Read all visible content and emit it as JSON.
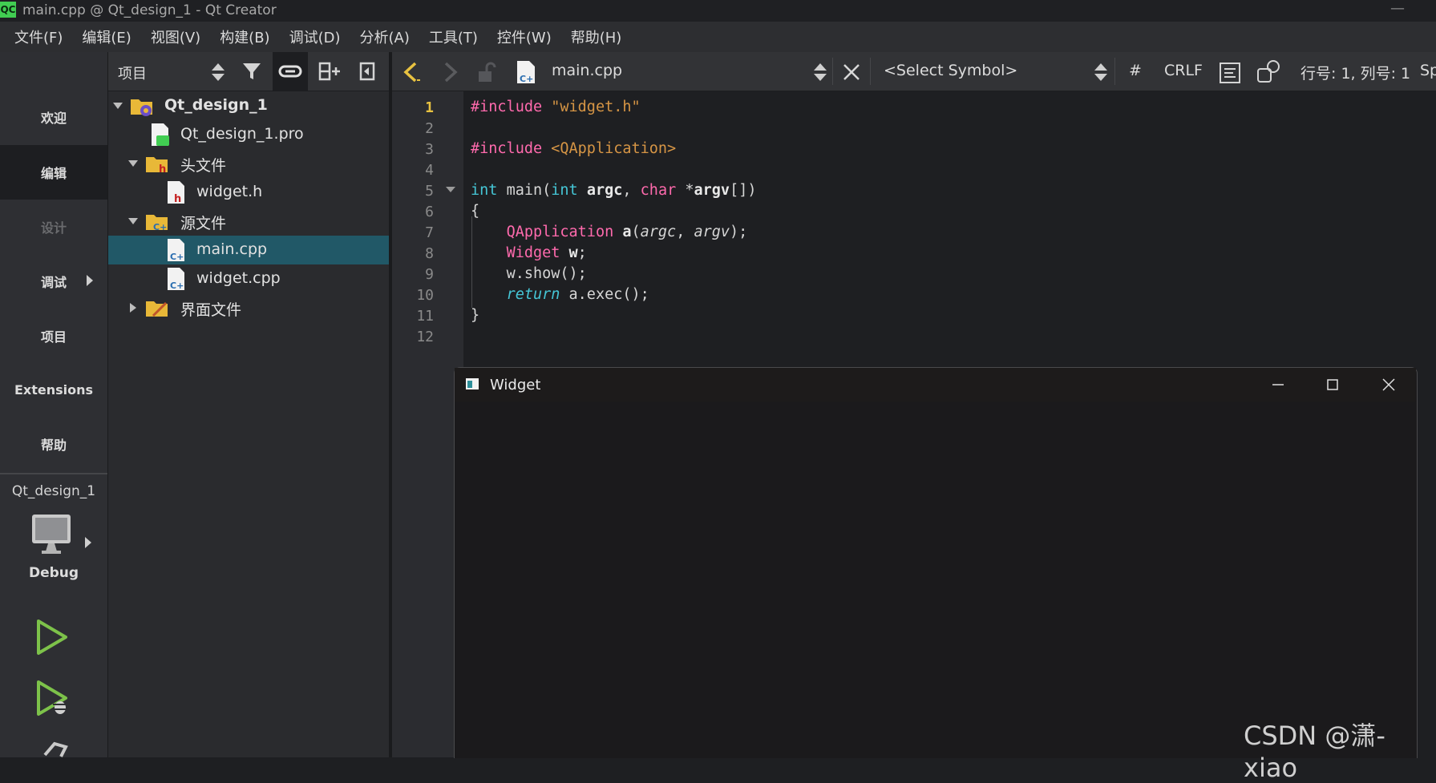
{
  "window": {
    "title": "main.cpp @ Qt_design_1 - Qt Creator",
    "logo_text": "QC",
    "minimize_glyph": "—"
  },
  "menu": [
    "文件(F)",
    "编辑(E)",
    "视图(V)",
    "构建(B)",
    "调试(D)",
    "分析(A)",
    "工具(T)",
    "控件(W)",
    "帮助(H)"
  ],
  "modes": {
    "welcome": "欢迎",
    "edit": "编辑",
    "design": "设计",
    "debug": "调试",
    "projects": "项目",
    "extensions": "Extensions",
    "help": "帮助",
    "active": "编辑"
  },
  "kit": {
    "project": "Qt_design_1",
    "build": "Debug"
  },
  "project_panel": {
    "view_label": "项目"
  },
  "tree": {
    "root": "Qt_design_1",
    "pro_file": "Qt_design_1.pro",
    "headers_folder": "头文件",
    "header_file": "widget.h",
    "sources_folder": "源文件",
    "source_main": "main.cpp",
    "source_widget": "widget.cpp",
    "forms_folder": "界面文件",
    "selected": "main.cpp"
  },
  "editor_toolbar": {
    "file": "main.cpp",
    "symbol": "<Select Symbol>",
    "hash": "#",
    "line_ending": "CRLF",
    "cursor": "行号: 1, 列号: 1",
    "spaces": "Sp"
  },
  "code": {
    "line_numbers": [
      "1",
      "2",
      "3",
      "4",
      "5",
      "6",
      "7",
      "8",
      "9",
      "10",
      "11",
      "12"
    ],
    "current_line": 1,
    "l1_pp": "#include",
    "l1_str": "\"widget.h\"",
    "l3_pp": "#include",
    "l3_str": "<QApplication>",
    "l5_int": "int",
    "l5_main": "main(",
    "l5_int2": "int",
    "l5_argc": "argc",
    "l5_comma": ", ",
    "l5_char": "char",
    "l5_star": "*",
    "l5_argv": "argv",
    "l5_end": "[])",
    "l6": "{",
    "l7_type": "QApplication",
    "l7_a": "a",
    "l7_open": "(",
    "l7_argc": "argc",
    "l7_comma": ", ",
    "l7_argv": "argv",
    "l7_end": ");",
    "l8_type": "Widget",
    "l8_w": "w",
    "l8_end": ";",
    "l9": "w.show();",
    "l10_ret": "return",
    "l10_rest": "a.exec();",
    "l11": "}"
  },
  "widget_window": {
    "title": "Widget"
  },
  "watermark": "CSDN @潇-xiao",
  "colors": {
    "selection": "#215867",
    "preprocessor": "#ff6aad",
    "string": "#d69545",
    "keyword": "#45c6d6",
    "current_line_number": "#e8c241",
    "run_green": "#7dc24a"
  }
}
